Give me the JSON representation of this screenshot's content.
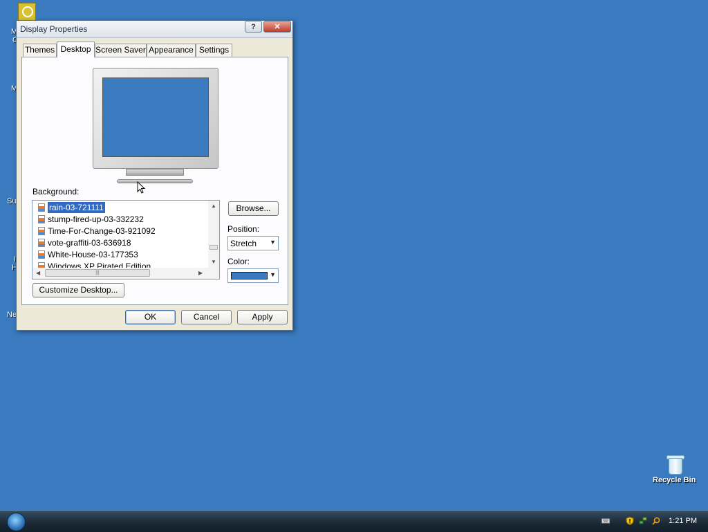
{
  "window": {
    "title": "Display Properties",
    "help_label": "?",
    "close_label": "✕"
  },
  "tabs": [
    {
      "label": "Themes",
      "active": false
    },
    {
      "label": "Desktop",
      "active": true
    },
    {
      "label": "Screen Saver",
      "active": false
    },
    {
      "label": "Appearance",
      "active": false
    },
    {
      "label": "Settings",
      "active": false
    }
  ],
  "desktop_tab": {
    "background_label": "Background:",
    "background_items": [
      {
        "label": "rain-03-721111",
        "selected": true
      },
      {
        "label": "stump-fired-up-03-332232",
        "selected": false
      },
      {
        "label": "Time-For-Change-03-921092",
        "selected": false
      },
      {
        "label": "vote-graffiti-03-636918",
        "selected": false
      },
      {
        "label": "White-House-03-177353",
        "selected": false
      },
      {
        "label": "Windows XP Pirated Edition",
        "selected": false
      }
    ],
    "browse_label": "Browse...",
    "position_label": "Position:",
    "position_value": "Stretch",
    "color_label": "Color:",
    "color_value": "#3a7abf",
    "customize_label": "Customize Desktop..."
  },
  "dialog_buttons": {
    "ok": "OK",
    "cancel": "Cancel",
    "apply": "Apply"
  },
  "desktop": {
    "background_color": "#3a7abf",
    "recycle_bin_label": "Recycle Bin",
    "left_icon_fragments": [
      "M",
      "C",
      "M",
      "Su",
      "I",
      "H",
      "Ne"
    ]
  },
  "taskbar": {
    "clock": "1:21 PM",
    "tray_icons": [
      "keyboard-icon",
      "security-shield-icon",
      "network-icon",
      "search-icon"
    ]
  }
}
